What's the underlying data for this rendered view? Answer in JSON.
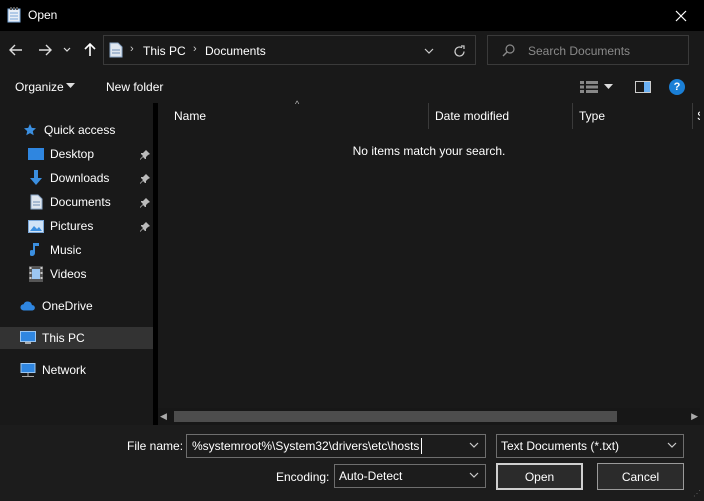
{
  "window": {
    "title": "Open",
    "icon": "notepad-icon",
    "close_icon": "close-icon"
  },
  "nav": {
    "back_icon": "arrow-left-icon",
    "forward_icon": "arrow-right-icon",
    "recent_icon": "chevron-down-icon",
    "up_icon": "arrow-up-icon",
    "breadcrumbs": [
      "This PC",
      "Documents"
    ],
    "refresh_icon": "refresh-icon",
    "search_placeholder": "Search Documents"
  },
  "toolbar": {
    "organize_label": "Organize",
    "new_folder_label": "New folder",
    "help_label": "?"
  },
  "sidebar": {
    "items": [
      {
        "label": "Quick access",
        "icon": "star-icon",
        "pinned": false
      },
      {
        "label": "Desktop",
        "icon": "desktop-icon",
        "pinned": true
      },
      {
        "label": "Downloads",
        "icon": "download-icon",
        "pinned": true
      },
      {
        "label": "Documents",
        "icon": "document-icon",
        "pinned": true
      },
      {
        "label": "Pictures",
        "icon": "pictures-icon",
        "pinned": true
      },
      {
        "label": "Music",
        "icon": "music-icon",
        "pinned": false
      },
      {
        "label": "Videos",
        "icon": "videos-icon",
        "pinned": false
      },
      {
        "label": "OneDrive",
        "icon": "cloud-icon",
        "pinned": false
      },
      {
        "label": "This PC",
        "icon": "computer-icon",
        "pinned": false,
        "selected": true
      },
      {
        "label": "Network",
        "icon": "network-icon",
        "pinned": false
      }
    ]
  },
  "file_list": {
    "columns": [
      "Name",
      "Date modified",
      "Type",
      "S"
    ],
    "empty_message": "No items match your search."
  },
  "footer": {
    "file_name_label": "File name:",
    "file_name_value": "%systemroot%\\System32\\drivers\\etc\\hosts",
    "file_type_value": "Text Documents (*.txt)",
    "encoding_label": "Encoding:",
    "encoding_value": "Auto-Detect",
    "open_label": "Open",
    "cancel_label": "Cancel"
  },
  "colors": {
    "background": "#191919",
    "titlebar": "#000000",
    "selected": "#333333",
    "accent": "#1a7fd6"
  }
}
